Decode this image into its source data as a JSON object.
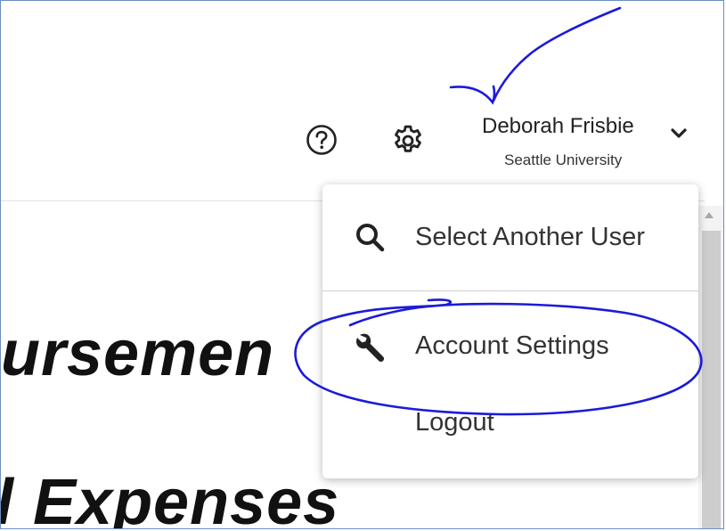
{
  "header": {
    "help_icon": "question-circle-icon",
    "settings_icon": "gear-icon",
    "user": {
      "name": "Deborah Frisbie",
      "organization": "Seattle University",
      "chevron_icon": "chevron-down-icon"
    }
  },
  "background": {
    "title_line_1": "ursemen",
    "title_line_2": "l Expenses"
  },
  "dropdown": {
    "items": [
      {
        "label": "Select Another User",
        "icon": "search-icon"
      },
      {
        "label": "Account Settings",
        "icon": "wrench-icon"
      },
      {
        "label": "Logout"
      }
    ]
  },
  "colors": {
    "annotation": "#1b1bd9",
    "text": "#333333",
    "frame_border": "#6b8fc4"
  }
}
